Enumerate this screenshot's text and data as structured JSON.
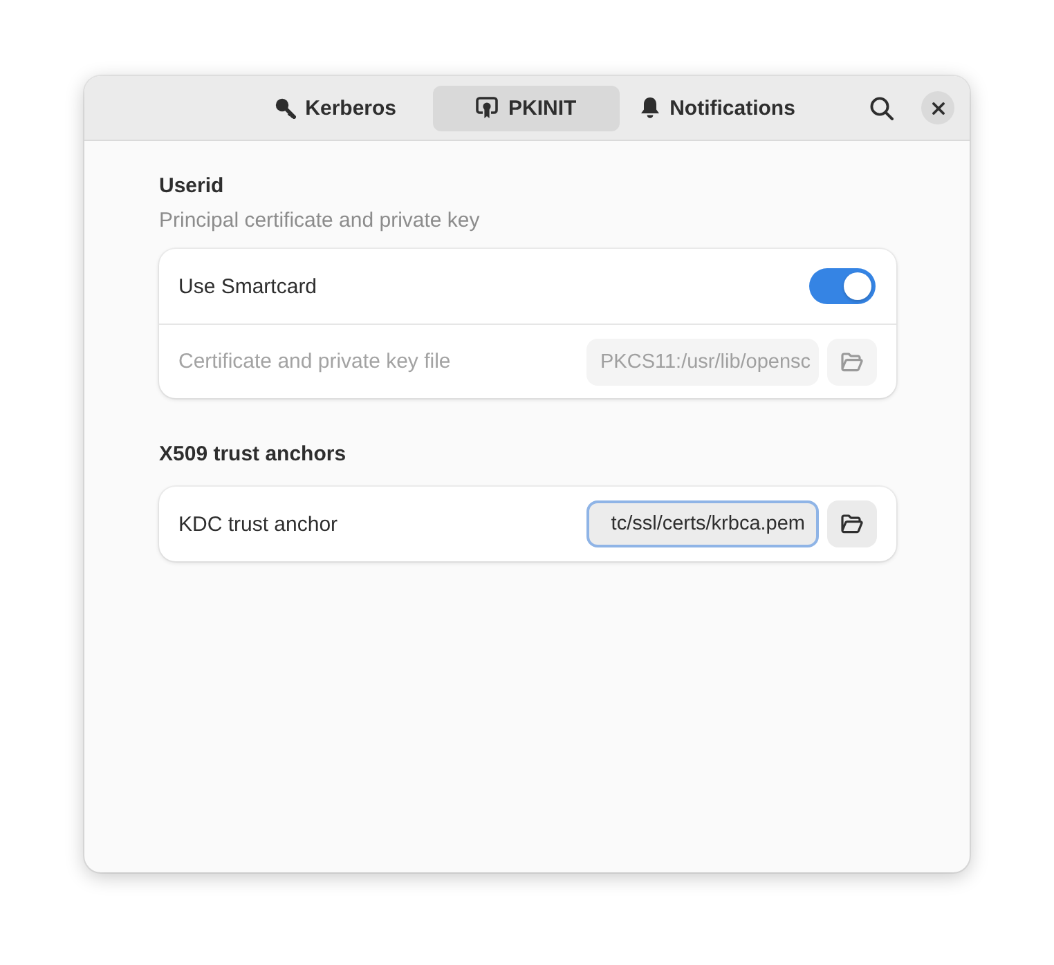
{
  "tabs": [
    {
      "label": "Kerberos",
      "selected": false
    },
    {
      "label": "PKINIT",
      "selected": true
    },
    {
      "label": "Notifications",
      "selected": false
    }
  ],
  "sections": [
    {
      "title": "Userid",
      "subtitle": "Principal certificate and private key",
      "rows": [
        {
          "kind": "switch",
          "label": "Use Smartcard",
          "on": true
        },
        {
          "kind": "file",
          "label": "Certificate and private key file",
          "value": "PKCS11:/usr/lib/opensc",
          "disabled": true,
          "focused": false
        }
      ]
    },
    {
      "title": "X509 trust anchors",
      "rows": [
        {
          "kind": "file",
          "label": "KDC trust anchor",
          "value": "tc/ssl/certs/krbca.pem",
          "disabled": false,
          "focused": true
        }
      ]
    }
  ]
}
